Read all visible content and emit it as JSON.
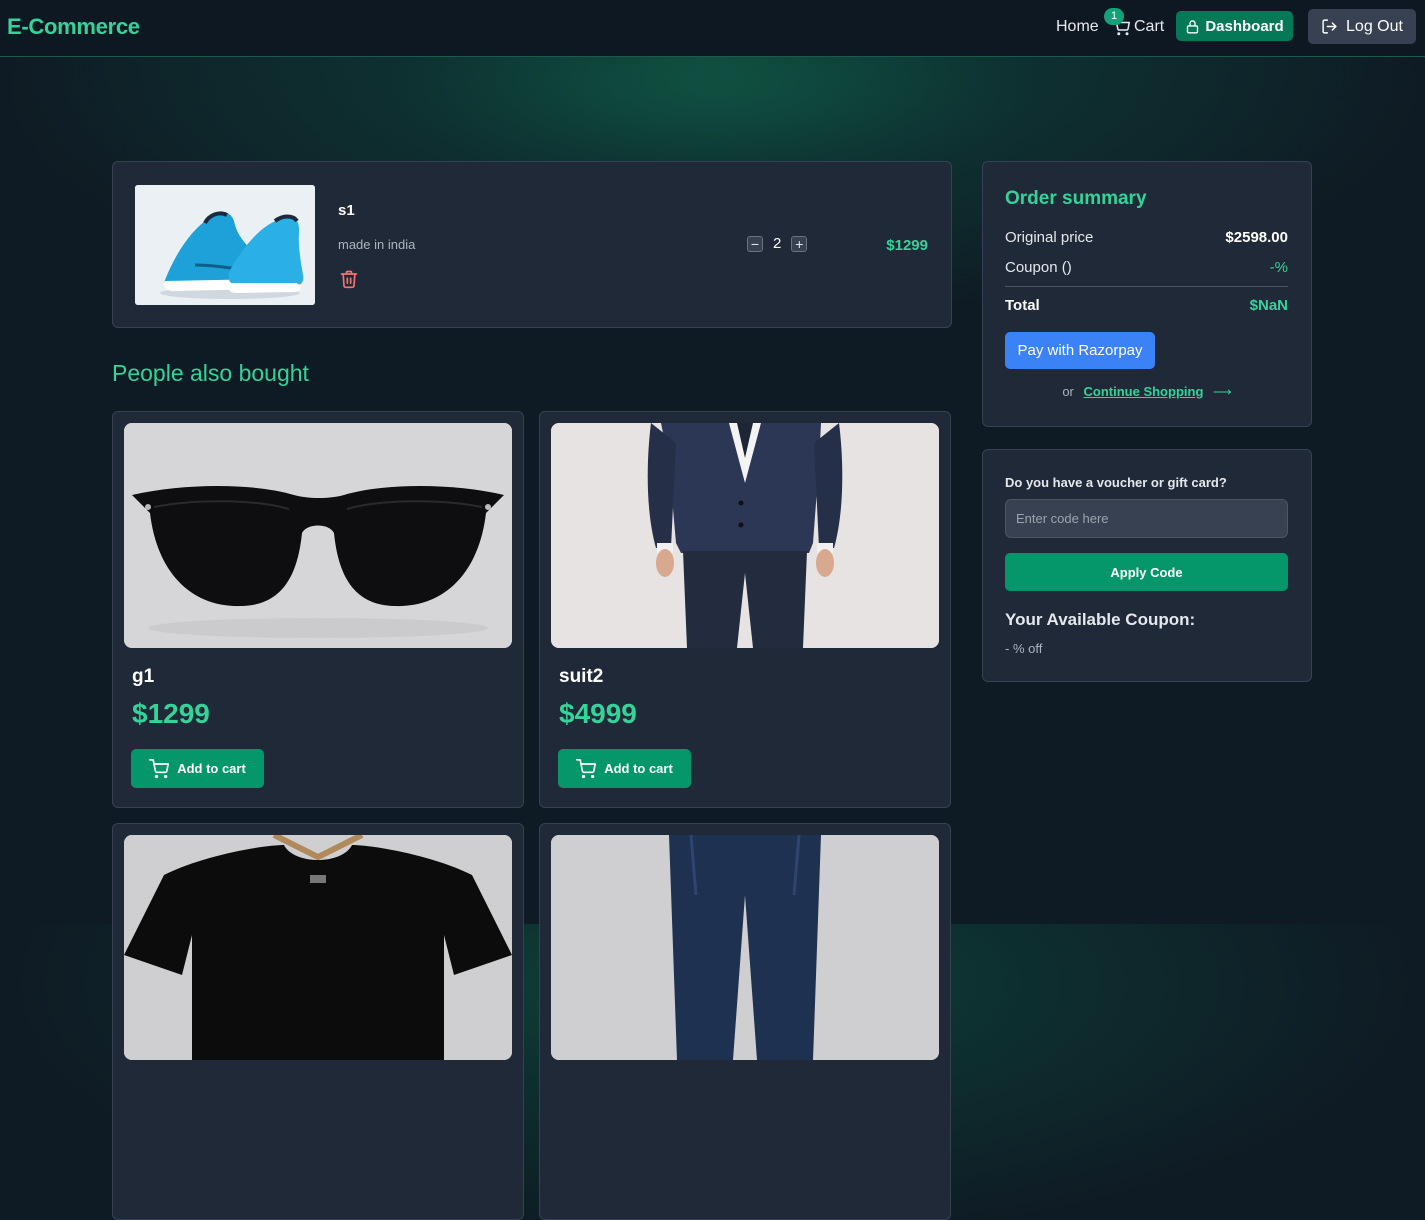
{
  "header": {
    "logo": "E-Commerce",
    "nav": {
      "home": "Home",
      "cart": "Cart",
      "cart_count": "1",
      "dashboard": "Dashboard",
      "logout": "Log Out"
    }
  },
  "cart": {
    "items": [
      {
        "name": "s1",
        "description": "made in india",
        "quantity": "2",
        "price": "$1299",
        "image": "blue-sneakers"
      }
    ]
  },
  "also_bought": {
    "title": "People also bought",
    "products": [
      {
        "name": "g1",
        "price": "$1299",
        "button": "Add to cart",
        "image": "black-sunglasses"
      },
      {
        "name": "suit2",
        "price": "$4999",
        "button": "Add to cart",
        "image": "navy-suit"
      },
      {
        "name": "",
        "price": "",
        "button": "",
        "image": "black-tshirt"
      },
      {
        "name": "",
        "price": "",
        "button": "",
        "image": "blue-jeans"
      }
    ]
  },
  "summary": {
    "title": "Order summary",
    "original_label": "Original price",
    "original_value": "$2598.00",
    "coupon_label": "Coupon ()",
    "coupon_value": "-%",
    "total_label": "Total",
    "total_value": "$NaN",
    "pay_button": "Pay with Razorpay",
    "or_text": "or",
    "continue_link": "Continue Shopping"
  },
  "voucher": {
    "label": "Do you have a voucher or gift card?",
    "placeholder": "Enter code here",
    "apply_button": "Apply Code",
    "available_title": "Your Available Coupon:",
    "available_text": "- % off"
  },
  "colors": {
    "accent": "#34d399",
    "primary_button": "#059669",
    "pay_button": "#3b82f6",
    "card": "#1f2937",
    "background": "#0f1b24"
  }
}
